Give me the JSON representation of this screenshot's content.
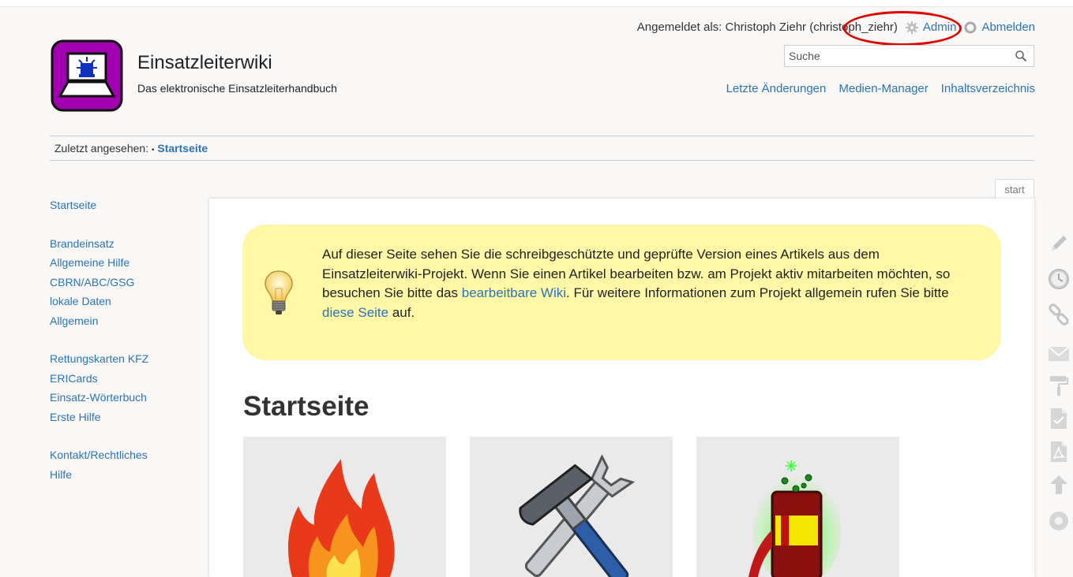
{
  "header": {
    "site_title": "Einsatzleiterwiki",
    "tagline": "Das elektronische Einsatzleiterhandbuch"
  },
  "usertools": {
    "logged_in_label": "Angemeldet als: Christoph Ziehr (christoph_ziehr)",
    "admin": "Admin",
    "logout": "Abmelden"
  },
  "search": {
    "placeholder": "Suche",
    "value": ""
  },
  "sitetools": {
    "recent": "Letzte Änderungen",
    "media": "Medien-Manager",
    "index": "Inhaltsverzeichnis"
  },
  "breadcrumbs": {
    "label": "Zuletzt angesehen:",
    "separator": "•",
    "current": "Startseite"
  },
  "sidebar": {
    "groups": [
      [
        "Startseite"
      ],
      [
        "Brandeinsatz",
        "Allgemeine Hilfe",
        "CBRN/ABC/GSG",
        "lokale Daten",
        "Allgemein"
      ],
      [
        "Rettungskarten KFZ",
        "ERICards",
        "Einsatz-Wörterbuch",
        "Erste Hilfe"
      ],
      [
        "Kontakt/Rechtliches",
        "Hilfe"
      ]
    ]
  },
  "page": {
    "id": "start",
    "heading": "Startseite",
    "note": {
      "t1": "Auf dieser Seite sehen Sie die schreibgeschützte und geprüfte Version eines Artikels aus dem Einsatzleiterwiki-Projekt. Wenn Sie einen Artikel bearbeiten bzw. am Projekt aktiv mitarbeiten möchten, so besuchen Sie bitte das ",
      "link1": "bearbeitbare Wiki",
      "t2": ". Für weitere Informationen zum Projekt allgemein rufen Sie bitte ",
      "link2": "diese Seite",
      "t3": " auf."
    }
  },
  "pagetools": [
    "pencil-icon",
    "clock-icon",
    "link-icon",
    "mail-icon",
    "paint-roller-icon",
    "odt-export-icon",
    "pdf-export-icon",
    "back-to-top-icon",
    "circle-icon"
  ],
  "colors": {
    "link": "#2b73b7",
    "note_background": "#fff8a7",
    "highlight_ellipse": "#e00000",
    "logo": "#a000b0"
  }
}
